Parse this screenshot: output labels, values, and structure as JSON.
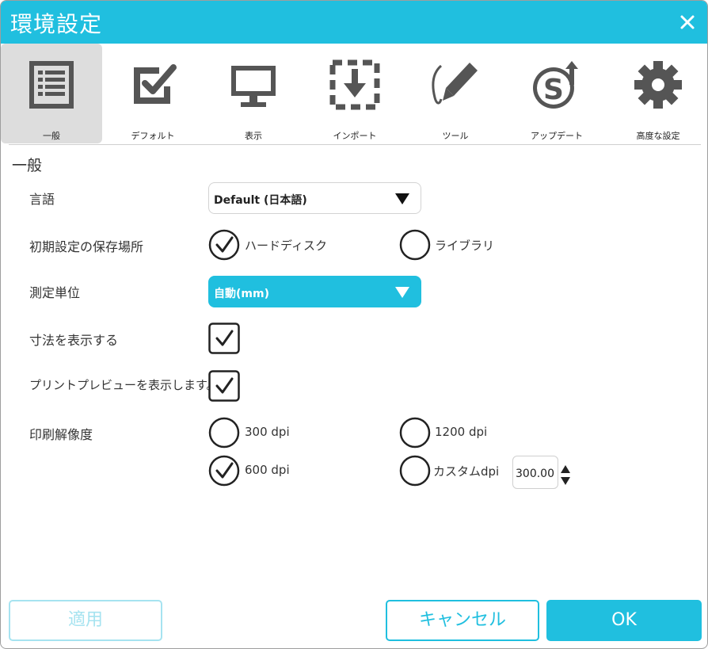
{
  "window": {
    "title": "環境設定",
    "close_icon": "close-icon"
  },
  "toolbar": {
    "items": [
      {
        "label": "一般",
        "icon": "general-list-icon",
        "active": true
      },
      {
        "label": "デフォルト",
        "icon": "checkbox-check-icon",
        "active": false
      },
      {
        "label": "表示",
        "icon": "monitor-icon",
        "active": false
      },
      {
        "label": "インポート",
        "icon": "import-arrow-icon",
        "active": false
      },
      {
        "label": "ツール",
        "icon": "pen-tool-icon",
        "active": false
      },
      {
        "label": "アップデート",
        "icon": "update-s-icon",
        "active": false
      },
      {
        "label": "高度な設定",
        "icon": "gear-icon",
        "active": false
      }
    ]
  },
  "general": {
    "section_title": "一般",
    "language": {
      "label": "言語",
      "value": "Default (日本語)"
    },
    "default_save": {
      "label": "初期設定の保存場所",
      "options": [
        {
          "label": "ハードディスク",
          "checked": true
        },
        {
          "label": "ライブラリ",
          "checked": false
        }
      ]
    },
    "unit": {
      "label": "測定単位",
      "value": "自動(mm)"
    },
    "show_dimensions": {
      "label": "寸法を表示する",
      "checked": true
    },
    "print_preview": {
      "label": "プリントプレビューを表示します。",
      "checked": true
    },
    "print_resolution": {
      "label": "印刷解像度",
      "options": [
        {
          "label": "300 dpi",
          "checked": false
        },
        {
          "label": "1200 dpi",
          "checked": false
        },
        {
          "label": "600 dpi",
          "checked": true
        },
        {
          "label": "カスタムdpi",
          "checked": false
        }
      ],
      "custom_value": "300.00"
    }
  },
  "buttons": {
    "apply": "適用",
    "cancel": "キャンセル",
    "ok": "OK"
  },
  "colors": {
    "accent": "#20bfdf",
    "accent_light": "#a6e3f0",
    "active_tab_bg": "#dddddd",
    "icon_gray": "#555555"
  }
}
